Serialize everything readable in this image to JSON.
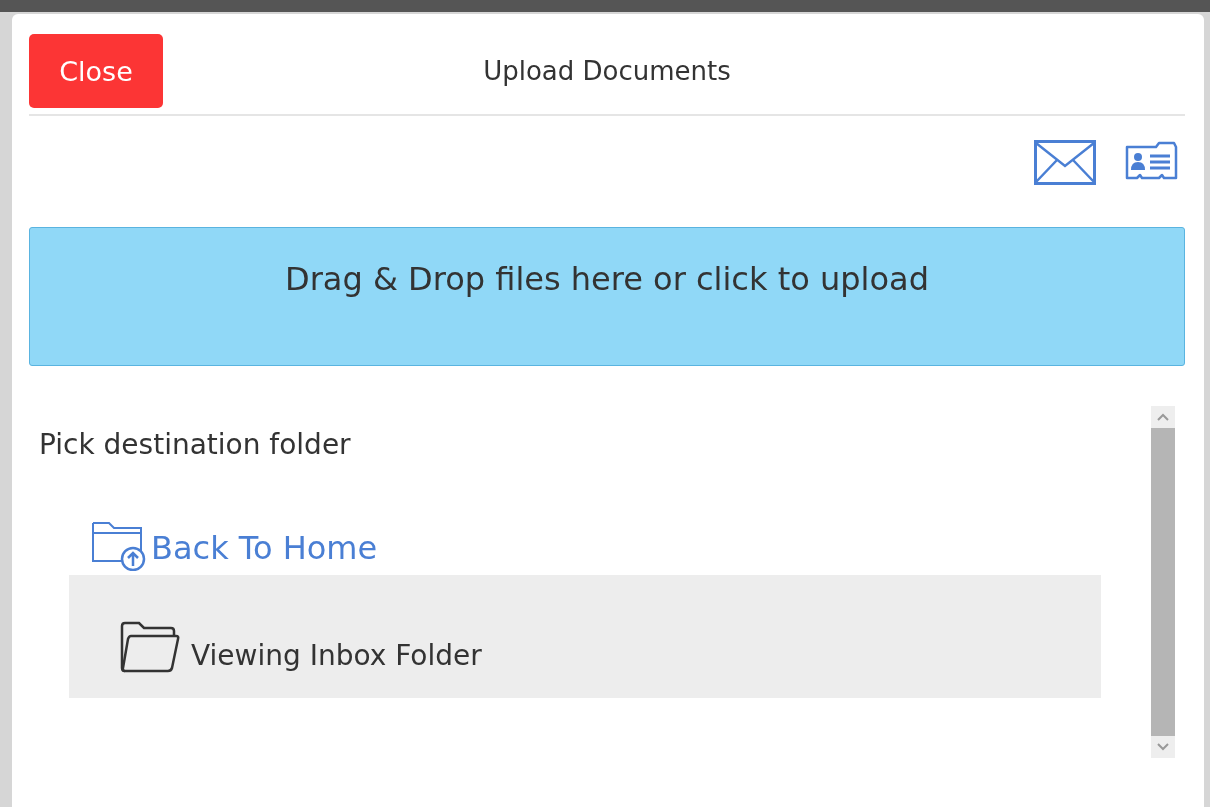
{
  "dialog": {
    "title": "Upload Documents",
    "close_button": "Close"
  },
  "drop_zone": {
    "text": "Drag & Drop files here or click to upload"
  },
  "folder_picker": {
    "heading": "Pick destination folder",
    "back_link": "Back To Home",
    "folders": [
      {
        "label": "Viewing Inbox Folder",
        "selected": true
      }
    ]
  }
}
